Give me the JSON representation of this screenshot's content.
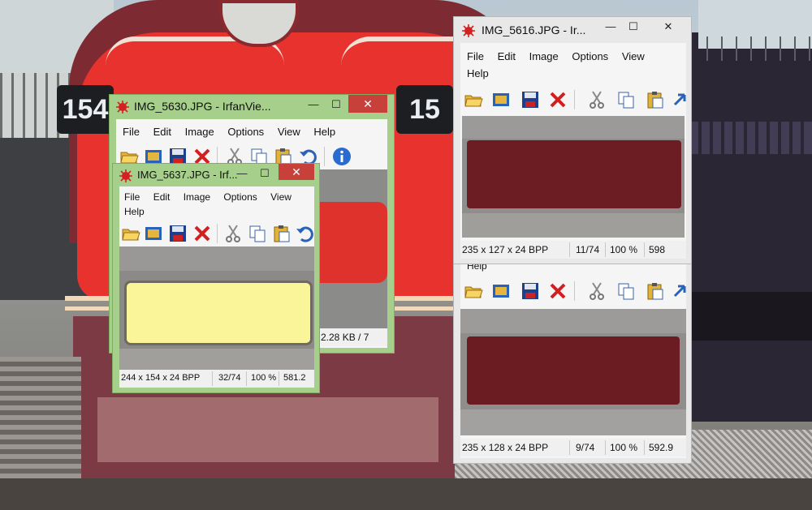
{
  "windows": {
    "win5630": {
      "title": "IMG_5630.JPG - IrfanVie...",
      "close": "✕",
      "minimize": "—",
      "maximize": "☐",
      "menu": [
        "File",
        "Edit",
        "Image",
        "Options",
        "View",
        "Help"
      ],
      "status_partial": "2.28 KB / 7"
    },
    "win5637": {
      "title": "IMG_5637.JPG - Irf...",
      "close": "✕",
      "minimize": "—",
      "maximize": "☐",
      "menu": [
        "File",
        "Edit",
        "Image",
        "Options",
        "View"
      ],
      "menu_row2": "Help",
      "status": {
        "dims": "244 x 154 x 24 BPP",
        "index": "32/74",
        "zoom": "100 %",
        "size": "581.2"
      }
    },
    "win5616": {
      "title": "IMG_5616.JPG - Ir...",
      "close": "✕",
      "minimize": "—",
      "maximize": "☐",
      "menu": [
        "File",
        "Edit",
        "Image",
        "Options",
        "View"
      ],
      "menu_row2": "Help",
      "status": {
        "dims": "235 x 127 x 24 BPP",
        "index": "11/74",
        "zoom": "100 %",
        "size": "598"
      }
    },
    "winLower": {
      "partial_menu": "Help",
      "status": {
        "dims": "235 x 128 x 24 BPP",
        "index": "9/74",
        "zoom": "100 %",
        "size": "592.9"
      }
    }
  },
  "background_number_left": "154",
  "background_number_right": "15",
  "colors": {
    "window_frame_active": "#a5cf8a",
    "window_frame_inactive": "#e8e8e8",
    "close_red": "#c7403a",
    "train_red": "#e8322e",
    "train_maroon": "#6e2430",
    "sign_yellow": "#fbf59a",
    "sign_maroon": "#6a1c22"
  }
}
